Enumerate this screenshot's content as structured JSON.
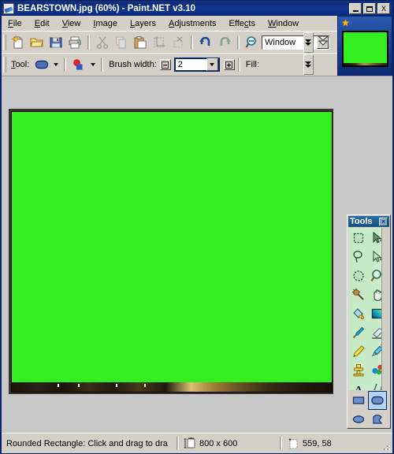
{
  "window": {
    "title": "BEARSTOWN.jpg (60%) - Paint.NET v3.10",
    "icon": "paintdotnet-icon",
    "minimize_label": "_",
    "maximize_label": "",
    "close_label": "X"
  },
  "menu": {
    "items": [
      {
        "label": "File",
        "mnemonic": "F"
      },
      {
        "label": "Edit",
        "mnemonic": "E"
      },
      {
        "label": "View",
        "mnemonic": "V"
      },
      {
        "label": "Image",
        "mnemonic": "I"
      },
      {
        "label": "Layers",
        "mnemonic": "L"
      },
      {
        "label": "Adjustments",
        "mnemonic": "A"
      },
      {
        "label": "Effects",
        "mnemonic": "c"
      },
      {
        "label": "Window",
        "mnemonic": "W"
      }
    ]
  },
  "toolbar_main": {
    "buttons": [
      {
        "name": "new-button",
        "tooltip": "New"
      },
      {
        "name": "open-button",
        "tooltip": "Open"
      },
      {
        "name": "save-button",
        "tooltip": "Save"
      },
      {
        "name": "print-button",
        "tooltip": "Print"
      },
      {
        "name": "cut-button",
        "tooltip": "Cut",
        "enabled": false
      },
      {
        "name": "copy-button",
        "tooltip": "Copy",
        "enabled": false
      },
      {
        "name": "paste-button",
        "tooltip": "Paste"
      },
      {
        "name": "crop-to-selection-button",
        "tooltip": "Crop to Selection",
        "enabled": false
      },
      {
        "name": "deselect-all-button",
        "tooltip": "Deselect All",
        "enabled": false
      },
      {
        "name": "undo-button",
        "tooltip": "Undo"
      },
      {
        "name": "redo-button",
        "tooltip": "Redo",
        "enabled": false
      },
      {
        "name": "zoom-button",
        "tooltip": "Zoom"
      }
    ],
    "zoom_value": "Window",
    "overflow_label": ""
  },
  "toolbar_tool": {
    "tool_label": "Tool:",
    "tool_mnemonic": "T",
    "brush_width_label": "Brush width:",
    "brush_width_value": "2",
    "brush_width_decrease": "−",
    "brush_width_increase": "+",
    "fill_label": "Fill:"
  },
  "tools_palette": {
    "title": "Tools",
    "close_label": "×",
    "selected_tool": "Rounded Rectangle",
    "tools": [
      {
        "name": "rectangle-select-tool",
        "label": "Rectangle Select"
      },
      {
        "name": "move-selected-tool",
        "label": "Move Selected Pixels"
      },
      {
        "name": "lasso-select-tool",
        "label": "Lasso Select"
      },
      {
        "name": "move-selection-tool",
        "label": "Move Selection"
      },
      {
        "name": "ellipse-select-tool",
        "label": "Ellipse Select"
      },
      {
        "name": "zoom-tool",
        "label": "Zoom"
      },
      {
        "name": "magic-wand-tool",
        "label": "Magic Wand"
      },
      {
        "name": "pan-tool",
        "label": "Pan"
      },
      {
        "name": "paint-bucket-tool",
        "label": "Paint Bucket"
      },
      {
        "name": "gradient-tool",
        "label": "Gradient"
      },
      {
        "name": "paintbrush-tool",
        "label": "Paintbrush"
      },
      {
        "name": "eraser-tool",
        "label": "Eraser"
      },
      {
        "name": "pencil-tool",
        "label": "Pencil"
      },
      {
        "name": "color-picker-tool",
        "label": "Color Picker"
      },
      {
        "name": "clone-stamp-tool",
        "label": "Clone Stamp"
      },
      {
        "name": "recolor-tool",
        "label": "Recolor"
      },
      {
        "name": "text-tool",
        "label": "Text"
      },
      {
        "name": "line-curve-tool",
        "label": "Line/Curve"
      },
      {
        "name": "rectangle-tool",
        "label": "Rectangle"
      },
      {
        "name": "rounded-rectangle-tool",
        "label": "Rounded Rectangle"
      },
      {
        "name": "ellipse-tool",
        "label": "Ellipse"
      },
      {
        "name": "freeform-shape-tool",
        "label": "Freeform Shape"
      }
    ]
  },
  "canvas": {
    "fill_color": "#34ee1f",
    "background_color": "#c8c8c8",
    "document_name": "BEARSTOWN.jpg",
    "zoom_percent": "60%"
  },
  "thumbnail_panel": {
    "icon": "star-icon",
    "image_color": "#34ee1f"
  },
  "statusbar": {
    "help_text": "Rounded Rectangle: Click and drag to dra",
    "size_icon": "image-size-icon",
    "size_text": "800 x 600",
    "cursor_icon": "cursor-position-icon",
    "cursor_text": "559, 58"
  },
  "colors": {
    "title_blue": "#0a246a",
    "face": "#d4d0c8",
    "canvas_green": "#34ee1f",
    "tools_green": "#c6ebc6"
  }
}
